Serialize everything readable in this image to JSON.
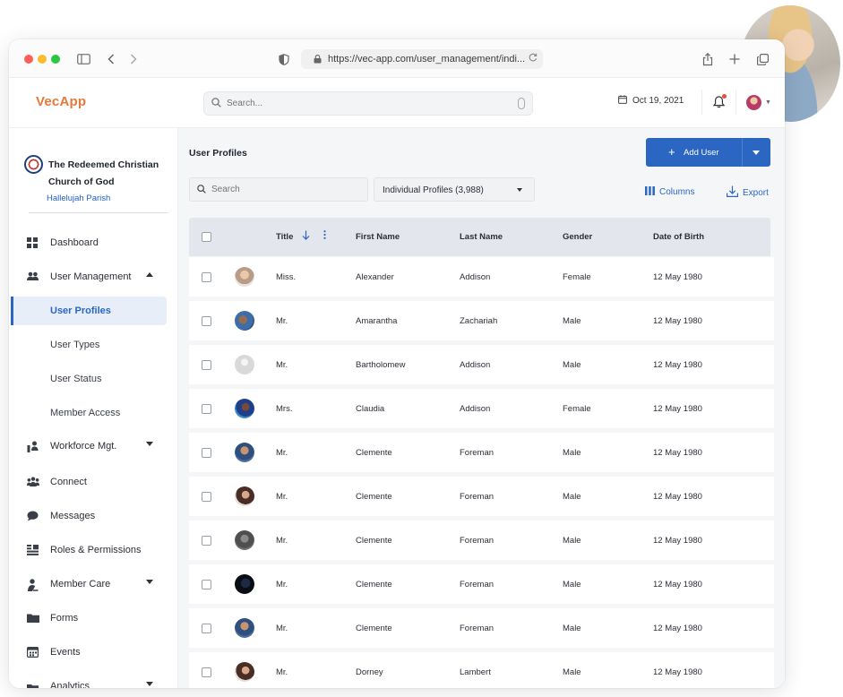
{
  "browser": {
    "url": "https://vec-app.com/user_management/indi..."
  },
  "app": {
    "logo": "VecApp",
    "search_placeholder": "Search...",
    "date": "Oct 19, 2021"
  },
  "sidebar": {
    "org_name": "The Redeemed Christian Church of God",
    "org_parish": "Hallelujah Parish",
    "items": [
      {
        "label": "Dashboard",
        "icon": "dashboard-icon"
      },
      {
        "label": "User Management",
        "icon": "users-icon",
        "expanded": true
      },
      {
        "label": "Workforce Mgt.",
        "icon": "workforce-icon"
      },
      {
        "label": "Connect",
        "icon": "connect-icon"
      },
      {
        "label": "Messages",
        "icon": "messages-icon"
      },
      {
        "label": "Roles & Permissions",
        "icon": "roles-icon"
      },
      {
        "label": "Member Care",
        "icon": "member-care-icon"
      },
      {
        "label": "Forms",
        "icon": "forms-icon"
      },
      {
        "label": "Events",
        "icon": "events-icon"
      },
      {
        "label": "Analytics",
        "icon": "analytics-icon"
      }
    ],
    "sub_items": [
      {
        "label": "User Profiles",
        "active": true
      },
      {
        "label": "User Types"
      },
      {
        "label": "User Status"
      },
      {
        "label": "Member Access"
      }
    ]
  },
  "main": {
    "title": "User Profiles",
    "add_button": "Add User",
    "search_placeholder": "Search",
    "profile_filter": "Individual Profiles (3,988)",
    "columns_label": "Columns",
    "export_label": "Export"
  },
  "table": {
    "headers": [
      "Title",
      "First Name",
      "Last Name",
      "Gender",
      "Date of Birth"
    ],
    "rows": [
      {
        "title": "Miss.",
        "first": "Alexander",
        "last": "Addison",
        "gender": "Female",
        "dob": "12 May 1980"
      },
      {
        "title": "Mr.",
        "first": "Amarantha",
        "last": "Zachariah",
        "gender": "Male",
        "dob": "12 May 1980"
      },
      {
        "title": "Mr.",
        "first": "Bartholomew",
        "last": "Addison",
        "gender": "Male",
        "dob": "12 May 1980"
      },
      {
        "title": "Mrs.",
        "first": "Claudia",
        "last": "Addison",
        "gender": "Female",
        "dob": "12 May 1980"
      },
      {
        "title": "Mr.",
        "first": "Clemente",
        "last": "Foreman",
        "gender": "Male",
        "dob": "12 May 1980"
      },
      {
        "title": "Mr.",
        "first": "Clemente",
        "last": "Foreman",
        "gender": "Male",
        "dob": "12 May 1980"
      },
      {
        "title": "Mr.",
        "first": "Clemente",
        "last": "Foreman",
        "gender": "Male",
        "dob": "12 May 1980"
      },
      {
        "title": "Mr.",
        "first": "Clemente",
        "last": "Foreman",
        "gender": "Male",
        "dob": "12 May 1980"
      },
      {
        "title": "Mr.",
        "first": "Clemente",
        "last": "Foreman",
        "gender": "Male",
        "dob": "12 May 1980"
      },
      {
        "title": "Mr.",
        "first": "Dorney",
        "last": "Lambert",
        "gender": "Male",
        "dob": "12 May 1980"
      }
    ]
  },
  "colors": {
    "accent": "#2c66c3",
    "logo": "#e7783b",
    "header_row": "#e3e6ec"
  }
}
